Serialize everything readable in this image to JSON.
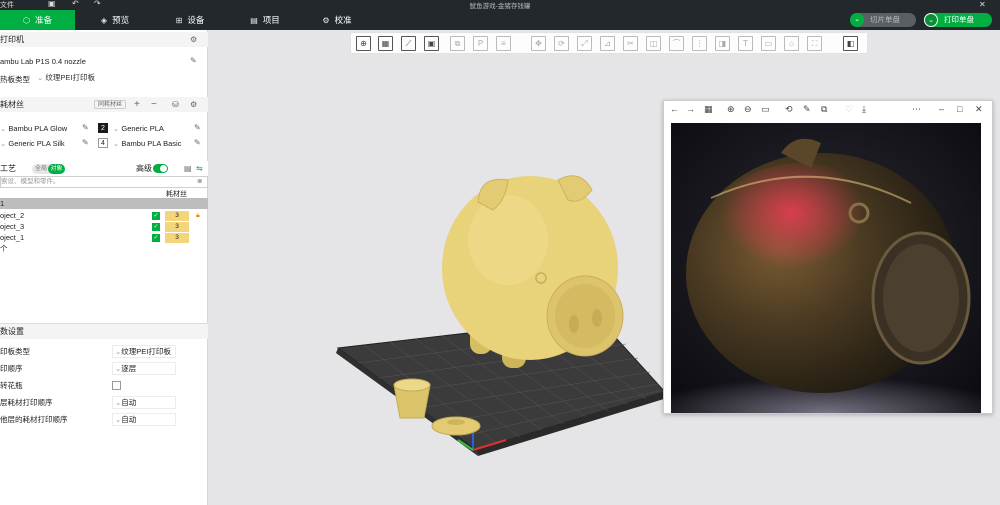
{
  "app": {
    "menu_file": "文件",
    "title": "鱿鱼游戏-金猪存钱罐"
  },
  "tabs": [
    {
      "label": "准备",
      "icon": "cube-icon"
    },
    {
      "label": "预览",
      "icon": "layers-icon"
    },
    {
      "label": "设备",
      "icon": "device-icon"
    },
    {
      "label": "项目",
      "icon": "project-icon"
    },
    {
      "label": "校准",
      "icon": "calibration-icon"
    }
  ],
  "actions": {
    "slice_label": "切片单盘",
    "print_label": "打印单盘"
  },
  "printer": {
    "section_title": "打印机",
    "printer_name": "ambu Lab P1S 0.4 nozzle",
    "plate_label": "热板类型",
    "plate_value": "纹理PEI打印板"
  },
  "filament": {
    "section_title": "耗材丝",
    "sync_label": "同耗材丝",
    "items": [
      {
        "name": "Bambu PLA Glow",
        "color": "#f2f2ee",
        "number": "1"
      },
      {
        "name": "Generic PLA",
        "color": "#1a1a1a",
        "number": "2"
      },
      {
        "name": "Generic PLA Silk",
        "color": "#e8d07a",
        "number": "3"
      },
      {
        "name": "Bambu PLA Basic",
        "color": "#ffffff",
        "number": "4"
      }
    ]
  },
  "process": {
    "section_title": "工艺",
    "toggle_global": "全局",
    "toggle_object": "对象",
    "advanced_label": "高级",
    "search_placeholder": "索设、模型和零件。",
    "column_filament": "耗材丝",
    "group": "1",
    "objects": [
      {
        "name": "oject_2",
        "filament": "3"
      },
      {
        "name": "oject_3",
        "filament": "3"
      },
      {
        "name": "oject_1",
        "filament": "3"
      }
    ],
    "footer_count": "个"
  },
  "params": {
    "section_title": "数设置",
    "rows": [
      {
        "label": "印板类型",
        "value": "纹理PEI打印板"
      },
      {
        "label": "印顺序",
        "value": "逐层"
      },
      {
        "label": "转花瓶",
        "value": ""
      },
      {
        "label": "层耗材打印顺序",
        "value": "自动"
      },
      {
        "label": "他层的耗材打印顺序",
        "value": "自动"
      }
    ]
  },
  "colors": {
    "accent": "#00ae42",
    "topbar": "#23282d",
    "model": "#e8d27a",
    "bed": "#3a3a3a"
  }
}
